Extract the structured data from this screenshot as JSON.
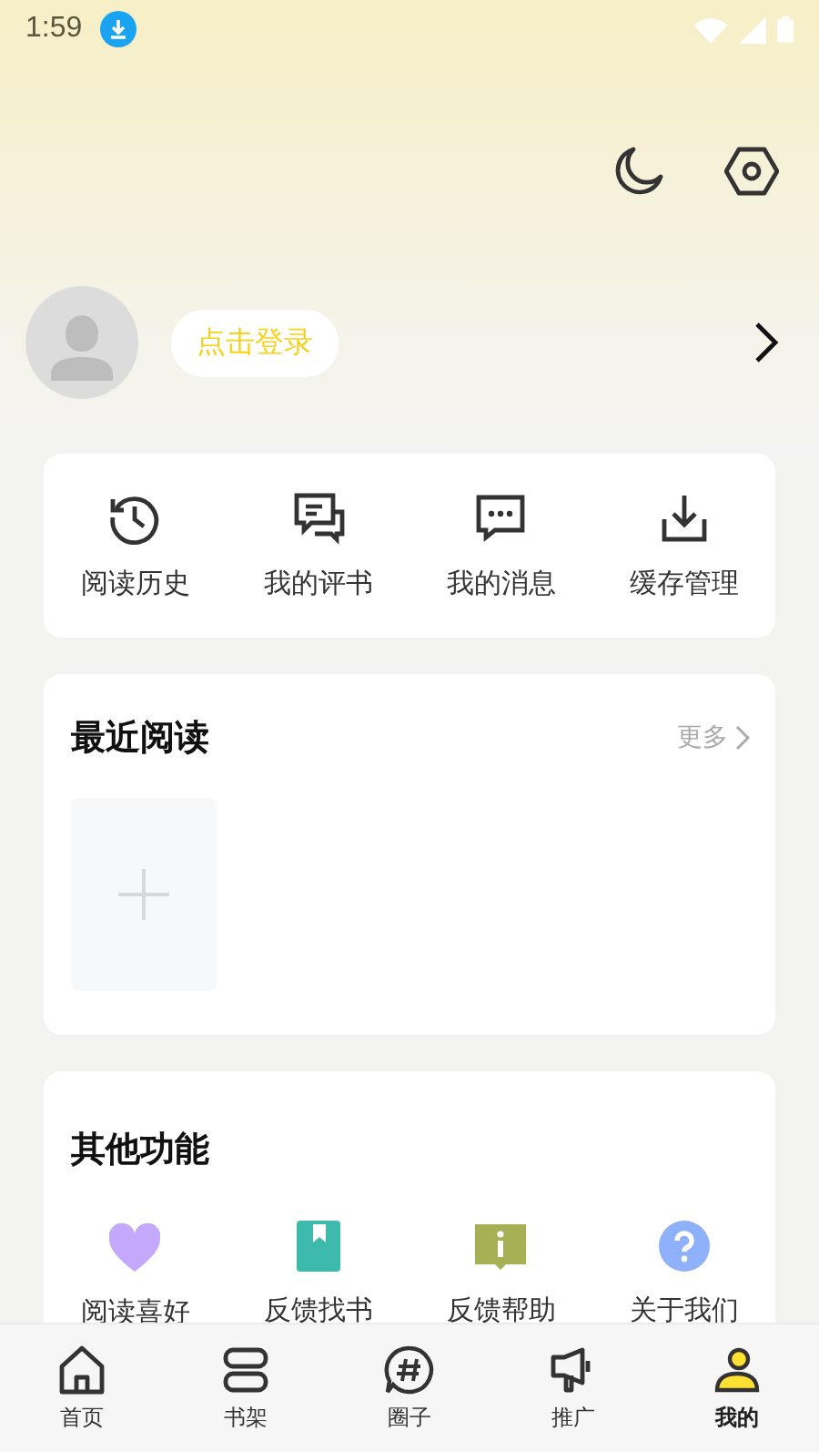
{
  "status_bar": {
    "time": "1:59"
  },
  "profile": {
    "login_button": "点击登录"
  },
  "shortcuts": [
    {
      "label": "阅读历史",
      "kind": "history"
    },
    {
      "label": "我的评书",
      "kind": "review"
    },
    {
      "label": "我的消息",
      "kind": "message"
    },
    {
      "label": "缓存管理",
      "kind": "download"
    }
  ],
  "recent": {
    "title": "最近阅读",
    "more": "更多"
  },
  "other": {
    "title": "其他功能",
    "items": [
      {
        "label": "阅读喜好",
        "kind": "heart"
      },
      {
        "label": "反馈找书",
        "kind": "book"
      },
      {
        "label": "反馈帮助",
        "kind": "info"
      },
      {
        "label": "关于我们",
        "kind": "question"
      }
    ]
  },
  "tabs": [
    {
      "label": "首页",
      "kind": "home",
      "selected": false
    },
    {
      "label": "书架",
      "kind": "shelf",
      "selected": false
    },
    {
      "label": "圈子",
      "kind": "hash",
      "selected": false
    },
    {
      "label": "推广",
      "kind": "megaphone",
      "selected": false
    },
    {
      "label": "我的",
      "kind": "person",
      "selected": true
    }
  ]
}
